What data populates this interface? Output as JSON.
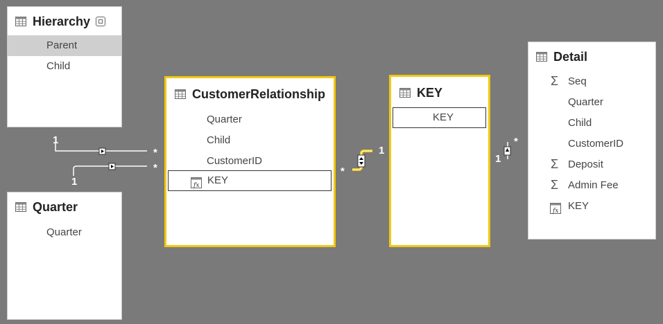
{
  "tables": {
    "hierarchy": {
      "title": "Hierarchy",
      "fields": [
        "Parent",
        "Child"
      ]
    },
    "quarter": {
      "title": "Quarter",
      "fields": [
        "Quarter"
      ]
    },
    "customer_relationship": {
      "title": "CustomerRelationship",
      "fields": [
        "Quarter",
        "Child",
        "CustomerID",
        "KEY"
      ]
    },
    "key": {
      "title": "KEY",
      "fields": [
        "KEY"
      ]
    },
    "detail": {
      "title": "Detail",
      "fields": [
        "Seq",
        "Quarter",
        "Child",
        "CustomerID",
        "Deposit",
        "Admin Fee",
        "KEY"
      ]
    }
  },
  "relationships": {
    "hierarchy_to_cr": {
      "from_card": "1",
      "to_card": "*"
    },
    "quarter_to_cr": {
      "from_card": "1",
      "to_card": "*"
    },
    "cr_to_key": {
      "from_card": "*",
      "to_card": "1"
    },
    "detail_to_key": {
      "from_card": "1",
      "to_card": "*"
    }
  },
  "colors": {
    "background": "#7a7a7a",
    "selected_border": "#f2c811",
    "line": "#ffffff"
  },
  "icons": {
    "table": "table-icon",
    "sum": "sigma-icon",
    "calculated": "calculated-column-icon",
    "collapse": "collapse-icon"
  }
}
